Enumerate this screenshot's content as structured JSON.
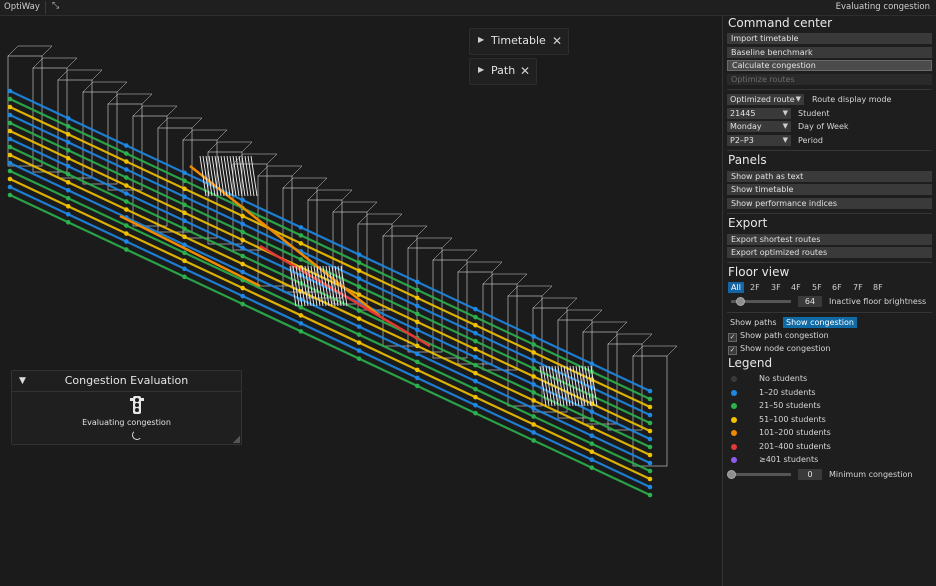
{
  "topbar": {
    "app_name": "OptiWay",
    "status": "Evaluating congestion"
  },
  "viewport_panels": {
    "timetable": {
      "title": "Timetable"
    },
    "path": {
      "title": "Path"
    },
    "congestion": {
      "title": "Congestion Evaluation",
      "message": "Evaluating congestion"
    }
  },
  "sidebar": {
    "command_center": {
      "title": "Command center",
      "buttons": [
        "Import timetable",
        "Baseline benchmark",
        "Calculate congestion",
        "Optimize routes"
      ]
    },
    "selectors": [
      {
        "value": "Optimized route",
        "label": "Route display mode"
      },
      {
        "value": "21445",
        "label": "Student"
      },
      {
        "value": "Monday",
        "label": "Day of Week"
      },
      {
        "value": "P2–P3",
        "label": "Period"
      }
    ],
    "panels": {
      "title": "Panels",
      "buttons": [
        "Show path as text",
        "Show timetable",
        "Show performance indices"
      ]
    },
    "export": {
      "title": "Export",
      "buttons": [
        "Export shortest routes",
        "Export optimized routes"
      ]
    },
    "floor_view": {
      "title": "Floor view",
      "tabs": [
        "All",
        "2F",
        "3F",
        "4F",
        "5F",
        "6F",
        "7F",
        "8F"
      ],
      "selected": "All",
      "brightness_value": "64",
      "brightness_label": "Inactive floor brightness",
      "brightness_level": 0.15
    },
    "display_toggle": {
      "paths": "Show paths",
      "congestion": "Show congestion",
      "selected": "Show congestion"
    },
    "checkboxes": [
      "Show path congestion",
      "Show node congestion"
    ],
    "legend": {
      "title": "Legend",
      "items": [
        {
          "label": "No students",
          "color": "#3a3a3a"
        },
        {
          "label": "1–20 students",
          "color": "#1e88e5"
        },
        {
          "label": "21–50 students",
          "color": "#2bb24c"
        },
        {
          "label": "51–100 students",
          "color": "#f2c200"
        },
        {
          "label": "101–200 students",
          "color": "#f08a00"
        },
        {
          "label": "201–400 students",
          "color": "#e53935"
        },
        {
          "label": "≥401 students",
          "color": "#8e5cf0"
        }
      ]
    },
    "min_congestion": {
      "value": "0",
      "label": "Minimum congestion",
      "level": 0
    }
  }
}
